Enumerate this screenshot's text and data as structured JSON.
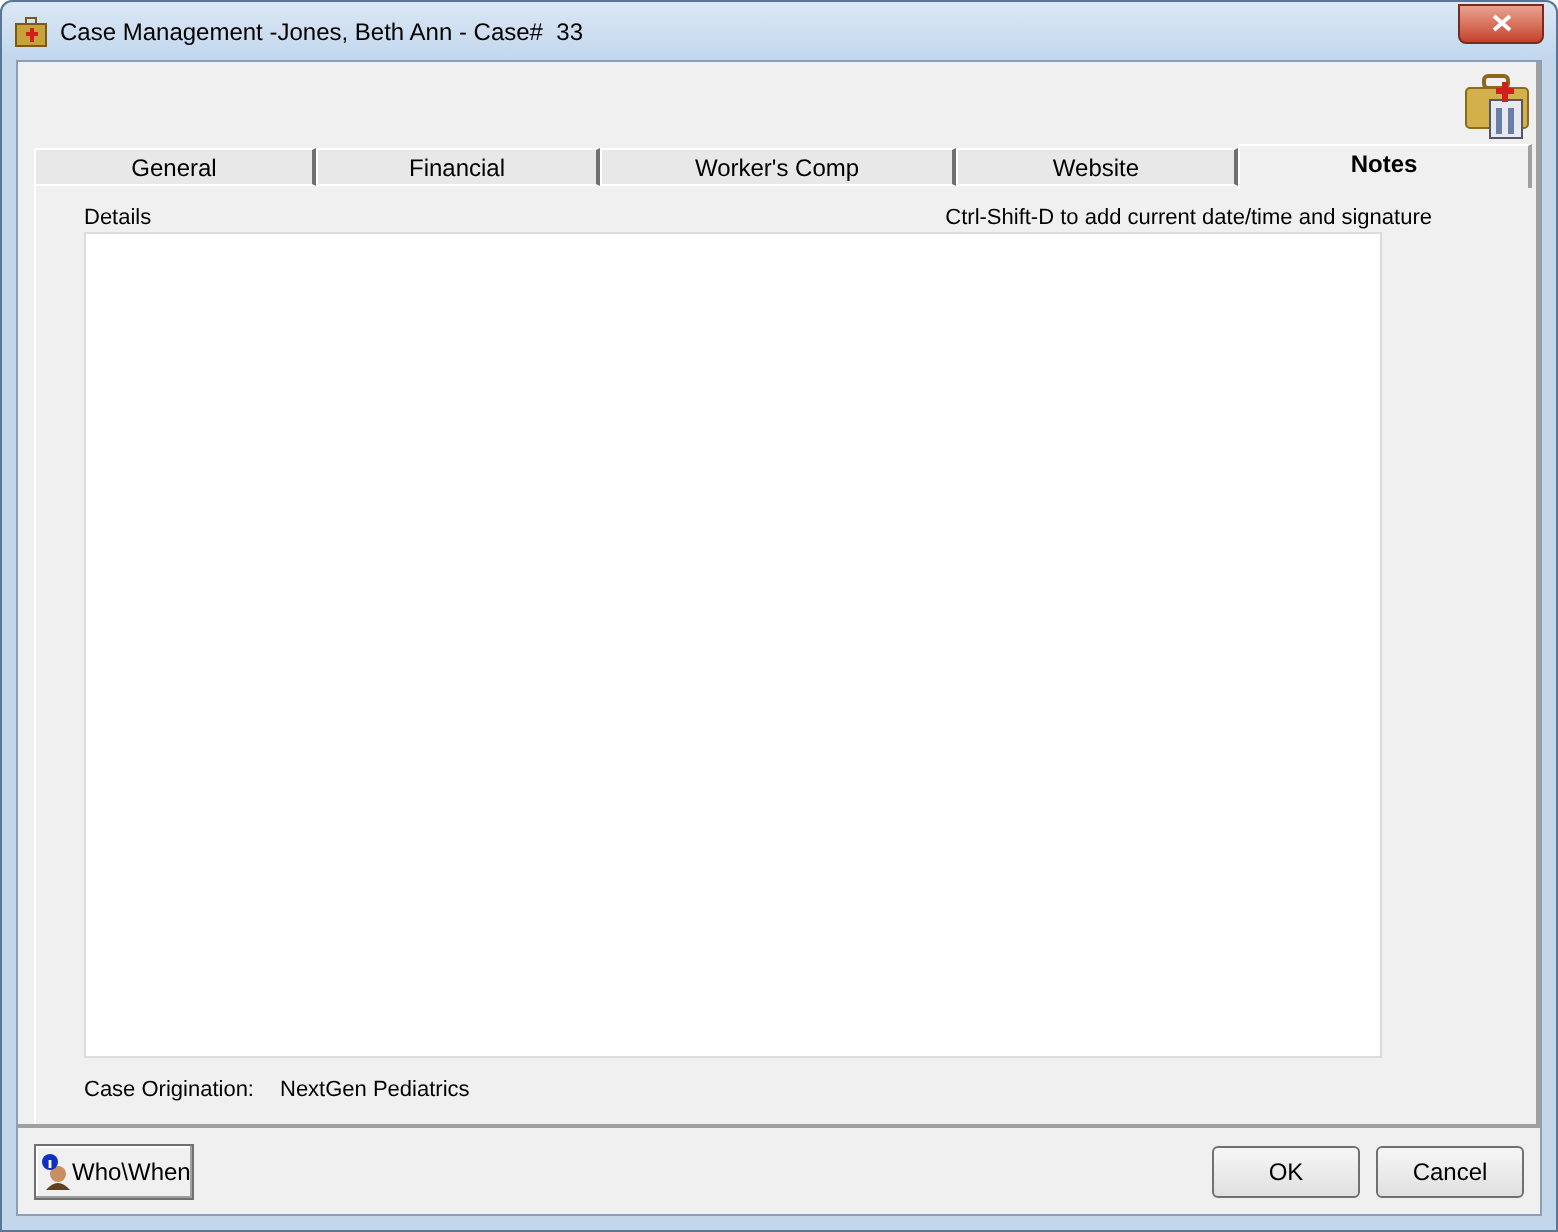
{
  "window": {
    "title": "Case Management -Jones, Beth Ann - Case#  33"
  },
  "tabs": [
    {
      "label": "General",
      "selected": false
    },
    {
      "label": "Financial",
      "selected": false
    },
    {
      "label": "Worker's Comp",
      "selected": false
    },
    {
      "label": "Website",
      "selected": false
    },
    {
      "label": "Notes",
      "selected": true
    }
  ],
  "notes": {
    "details_label": "Details",
    "hint": "Ctrl-Shift-D to add current date/time and signature",
    "origination_label": "Case Origination:",
    "origination_value": "NextGen Pediatrics"
  },
  "buttons": {
    "who_when": "Who\\When",
    "ok": "OK",
    "cancel": "Cancel"
  }
}
